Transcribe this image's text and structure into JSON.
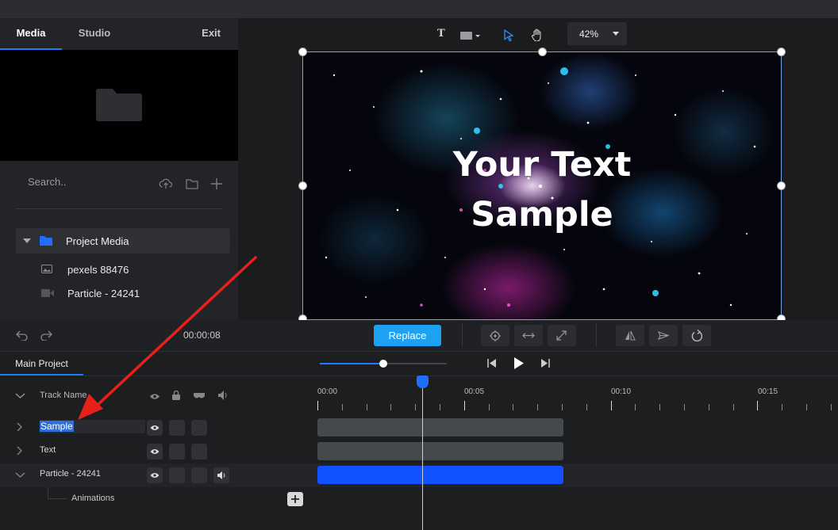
{
  "left_panel": {
    "tabs": [
      "Media",
      "Studio"
    ],
    "exit_label": "Exit",
    "search_placeholder": "Search..",
    "folder_label": "Project Media",
    "media_items": [
      {
        "name": "pexels 88476",
        "icon": "image-icon"
      },
      {
        "name": "Particle - 24241",
        "icon": "video-icon"
      }
    ]
  },
  "stage_toolbar": {
    "text_tool": "T",
    "zoom": "42%"
  },
  "canvas": {
    "line1": "Your Text",
    "line2": "Sample"
  },
  "controls": {
    "time": "00:00:08",
    "replace_label": "Replace"
  },
  "timeline": {
    "tab": "Main Project",
    "header_label": "Track Name",
    "tracks": [
      {
        "name": "Sample",
        "selected": true
      },
      {
        "name": "Text"
      },
      {
        "name": "Particle - 24241"
      }
    ],
    "sub_item": "Animations",
    "ruler": [
      "00:00",
      "00:05",
      "00:10",
      "00:15"
    ]
  },
  "colors": {
    "accent": "#1e7bff",
    "replace": "#1da1f2",
    "clip_blue": "#1251ff",
    "annotation": "#e8201b"
  }
}
